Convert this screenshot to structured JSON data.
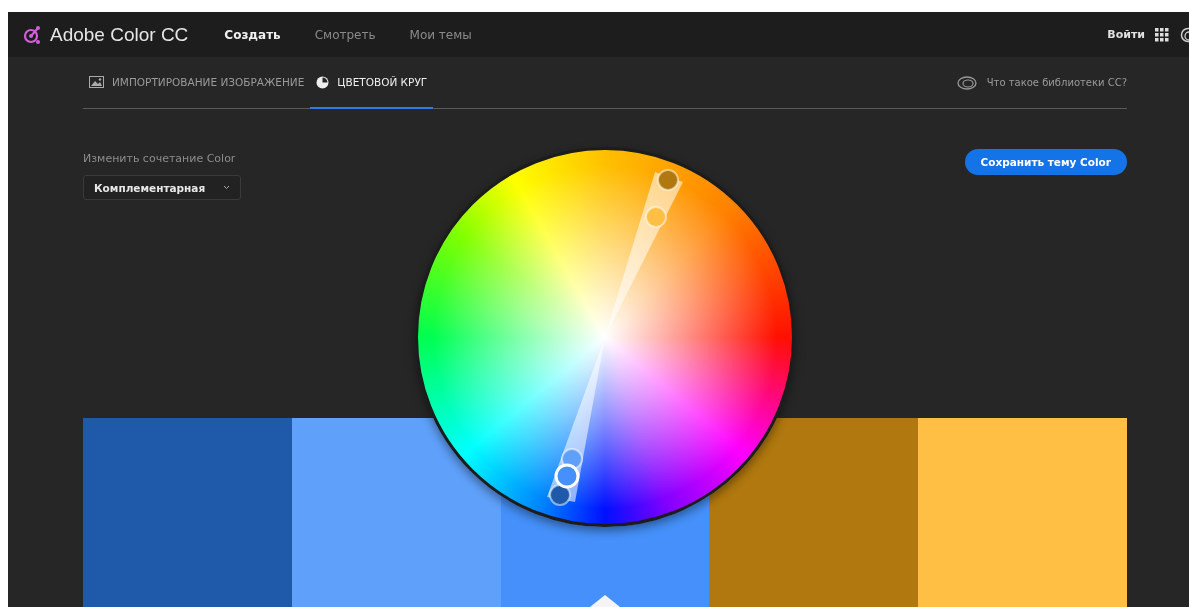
{
  "header": {
    "logo": "Adobe Color CC",
    "nav": [
      {
        "label": "Создать",
        "selected": true
      },
      {
        "label": "Смотреть",
        "selected": false
      },
      {
        "label": "Мои темы",
        "selected": false
      }
    ],
    "login": "Войти"
  },
  "subnav": {
    "tabs": [
      {
        "label": "ИМПОРТИРОВАНИЕ ИЗОБРАЖЕНИЕ",
        "selected": false
      },
      {
        "label": "ЦВЕТОВОЙ КРУГ",
        "selected": true
      }
    ],
    "help_link": "Что такое библиотеки CC?"
  },
  "rule": {
    "label": "Изменить сочетание Color",
    "value": "Комплементарная"
  },
  "save_button": "Сохранить тему Color",
  "swatches": [
    {
      "color": "#1f5aaa",
      "selected": false
    },
    {
      "color": "#5ea0fa",
      "selected": false
    },
    {
      "color": "#4590fa",
      "selected": true
    },
    {
      "color": "#b0780e",
      "selected": false
    },
    {
      "color": "#ffbf45",
      "selected": false
    }
  ]
}
